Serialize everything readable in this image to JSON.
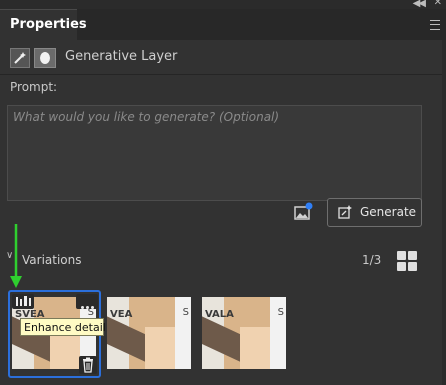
{
  "window": {
    "tab_title": "Properties"
  },
  "layer": {
    "title": "Generative Layer"
  },
  "prompt": {
    "label": "Prompt:",
    "placeholder": "What would you like to generate? (Optional)"
  },
  "actions": {
    "generate_label": "Generate"
  },
  "variations": {
    "label": "Variations",
    "counter": "1/3",
    "selected_index": 0,
    "thumbnails": [
      {
        "text_left": "SVEA",
        "text_right": "S"
      },
      {
        "text_left": "VEA",
        "text_right": "S"
      },
      {
        "text_left": "VALA",
        "text_right": "S"
      }
    ],
    "tooltip": "Enhance detail"
  },
  "colors": {
    "panel_bg": "#323232",
    "accent": "#2b6fdb",
    "tooltip_bg": "#fffbc4",
    "arrow": "#2fcf2f"
  }
}
